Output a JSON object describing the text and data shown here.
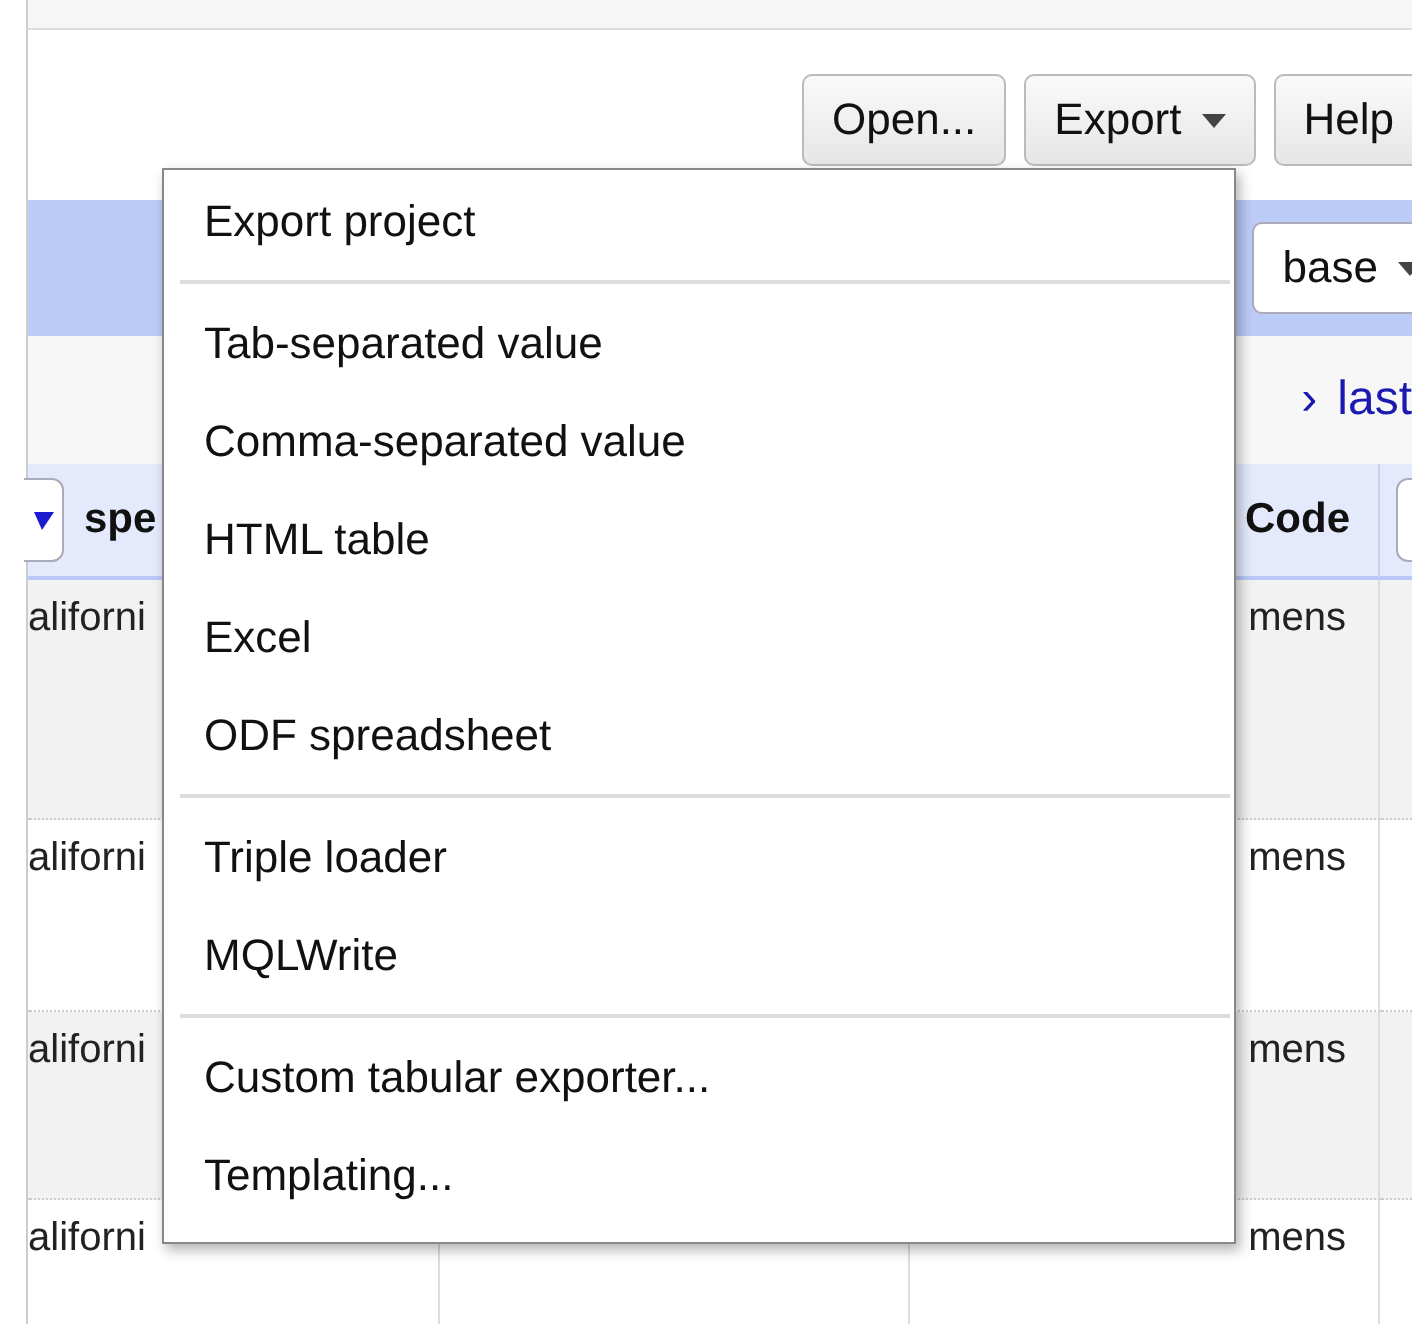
{
  "toolbar": {
    "buttons": [
      {
        "label": "Open...",
        "dropdown": false
      },
      {
        "label": "Export",
        "dropdown": true
      },
      {
        "label": "Help",
        "dropdown": false
      }
    ]
  },
  "band": {
    "button": {
      "label": "base",
      "dropdown": true
    }
  },
  "pager": {
    "links": [
      "›",
      "last"
    ]
  },
  "table": {
    "header": {
      "column_1": "spe",
      "column_3": "Code"
    },
    "rows": [
      {
        "column_1": "aliforni",
        "column_3": "mens"
      },
      {
        "column_1": "aliforni",
        "column_3": "mens"
      },
      {
        "column_1": "aliforni",
        "column_3": "mens"
      },
      {
        "column_1": "aliforni",
        "column_3": "mens"
      }
    ]
  },
  "export_menu": {
    "groups": [
      [
        "Export project"
      ],
      [
        "Tab-separated value",
        "Comma-separated value",
        "HTML table",
        "Excel",
        "ODF spreadsheet"
      ],
      [
        "Triple loader",
        "MQLWrite"
      ],
      [
        "Custom tabular exporter...",
        "Templating..."
      ]
    ]
  }
}
